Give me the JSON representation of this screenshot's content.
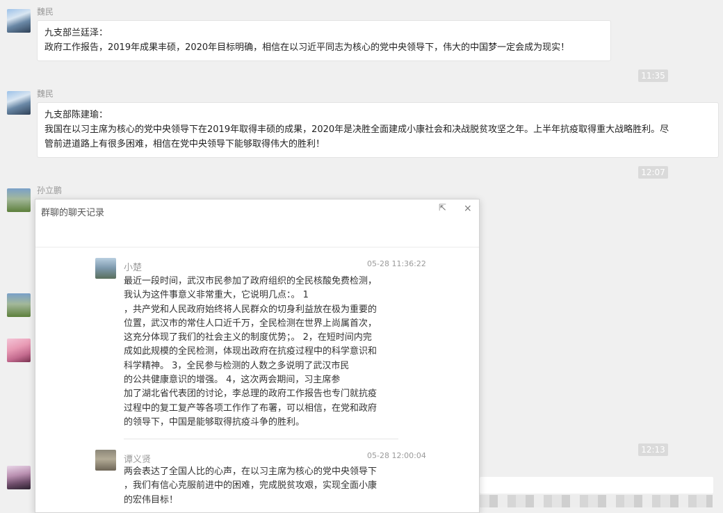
{
  "messages": [
    {
      "sender": "魏民",
      "lines": [
        "九支部兰廷泽：",
        "政府工作报告，2019年成果丰硕，2020年目标明确，相信在以习近平同志为核心的党中央领导下，伟大的中国梦一定会成为现实！"
      ]
    },
    {
      "sender": "魏民",
      "lines": [
        "九支部陈建瑜：",
        "我国在以习主席为核心的党中央领导下在2019年取得丰硕的成果，2020年是决胜全面建成小康社会和决战脱贫攻坚之年。上半年抗疫取得重大战略胜利。尽",
        "管前进道路上有很多困难，相信在党中央领导下能够取得伟大的胜利！"
      ]
    },
    {
      "sender": "孙立鹏"
    }
  ],
  "timestamps": [
    "11:35",
    "12:07",
    "12:13"
  ],
  "popup": {
    "title": "群聊的聊天记录",
    "controls": {
      "popout": "⇱",
      "close": "×"
    },
    "records": [
      {
        "name": "小楚",
        "time": "05-28 11:36:22",
        "lines": [
          "最近一段时间，武汉市民参加了政府组织的全民核酸免费检测，",
          "我认为这件事意义非常重大，它说明几点：。                    1",
          "，共产党和人民政府始终将人民群众的切身利益放在极为重要的",
          "位置，武汉市的常住人口近千万，全民检测在世界上尚属首次，",
          "这充分体现了我们的社会主义的制度优势；。  2，在短时间内完",
          "成如此规模的全民检测，体现出政府在抗疫过程中的科学意识和",
          "科学精神。            3，全民参与检测的人数之多说明了武汉市民",
          "的公共健康意识的增强。            4，这次两会期间，习主席参",
          "加了湖北省代表团的讨论，李总理的政府工作报告也专门就抗疫",
          "过程中的复工复产等各项工作作了布署，可以相信，在党和政府",
          "的领导下，中国是能够取得抗疫斗争的胜利。"
        ]
      },
      {
        "name": "谭义贤",
        "time": "05-28 12:00:04",
        "lines": [
          "两会表达了全国人比的心声，在以习主席为核心的党中央领导下",
          "，我们有信心克服前进中的困难，完成脱贫攻艰，实现全面小康",
          "的宏伟目标！"
        ]
      }
    ]
  }
}
